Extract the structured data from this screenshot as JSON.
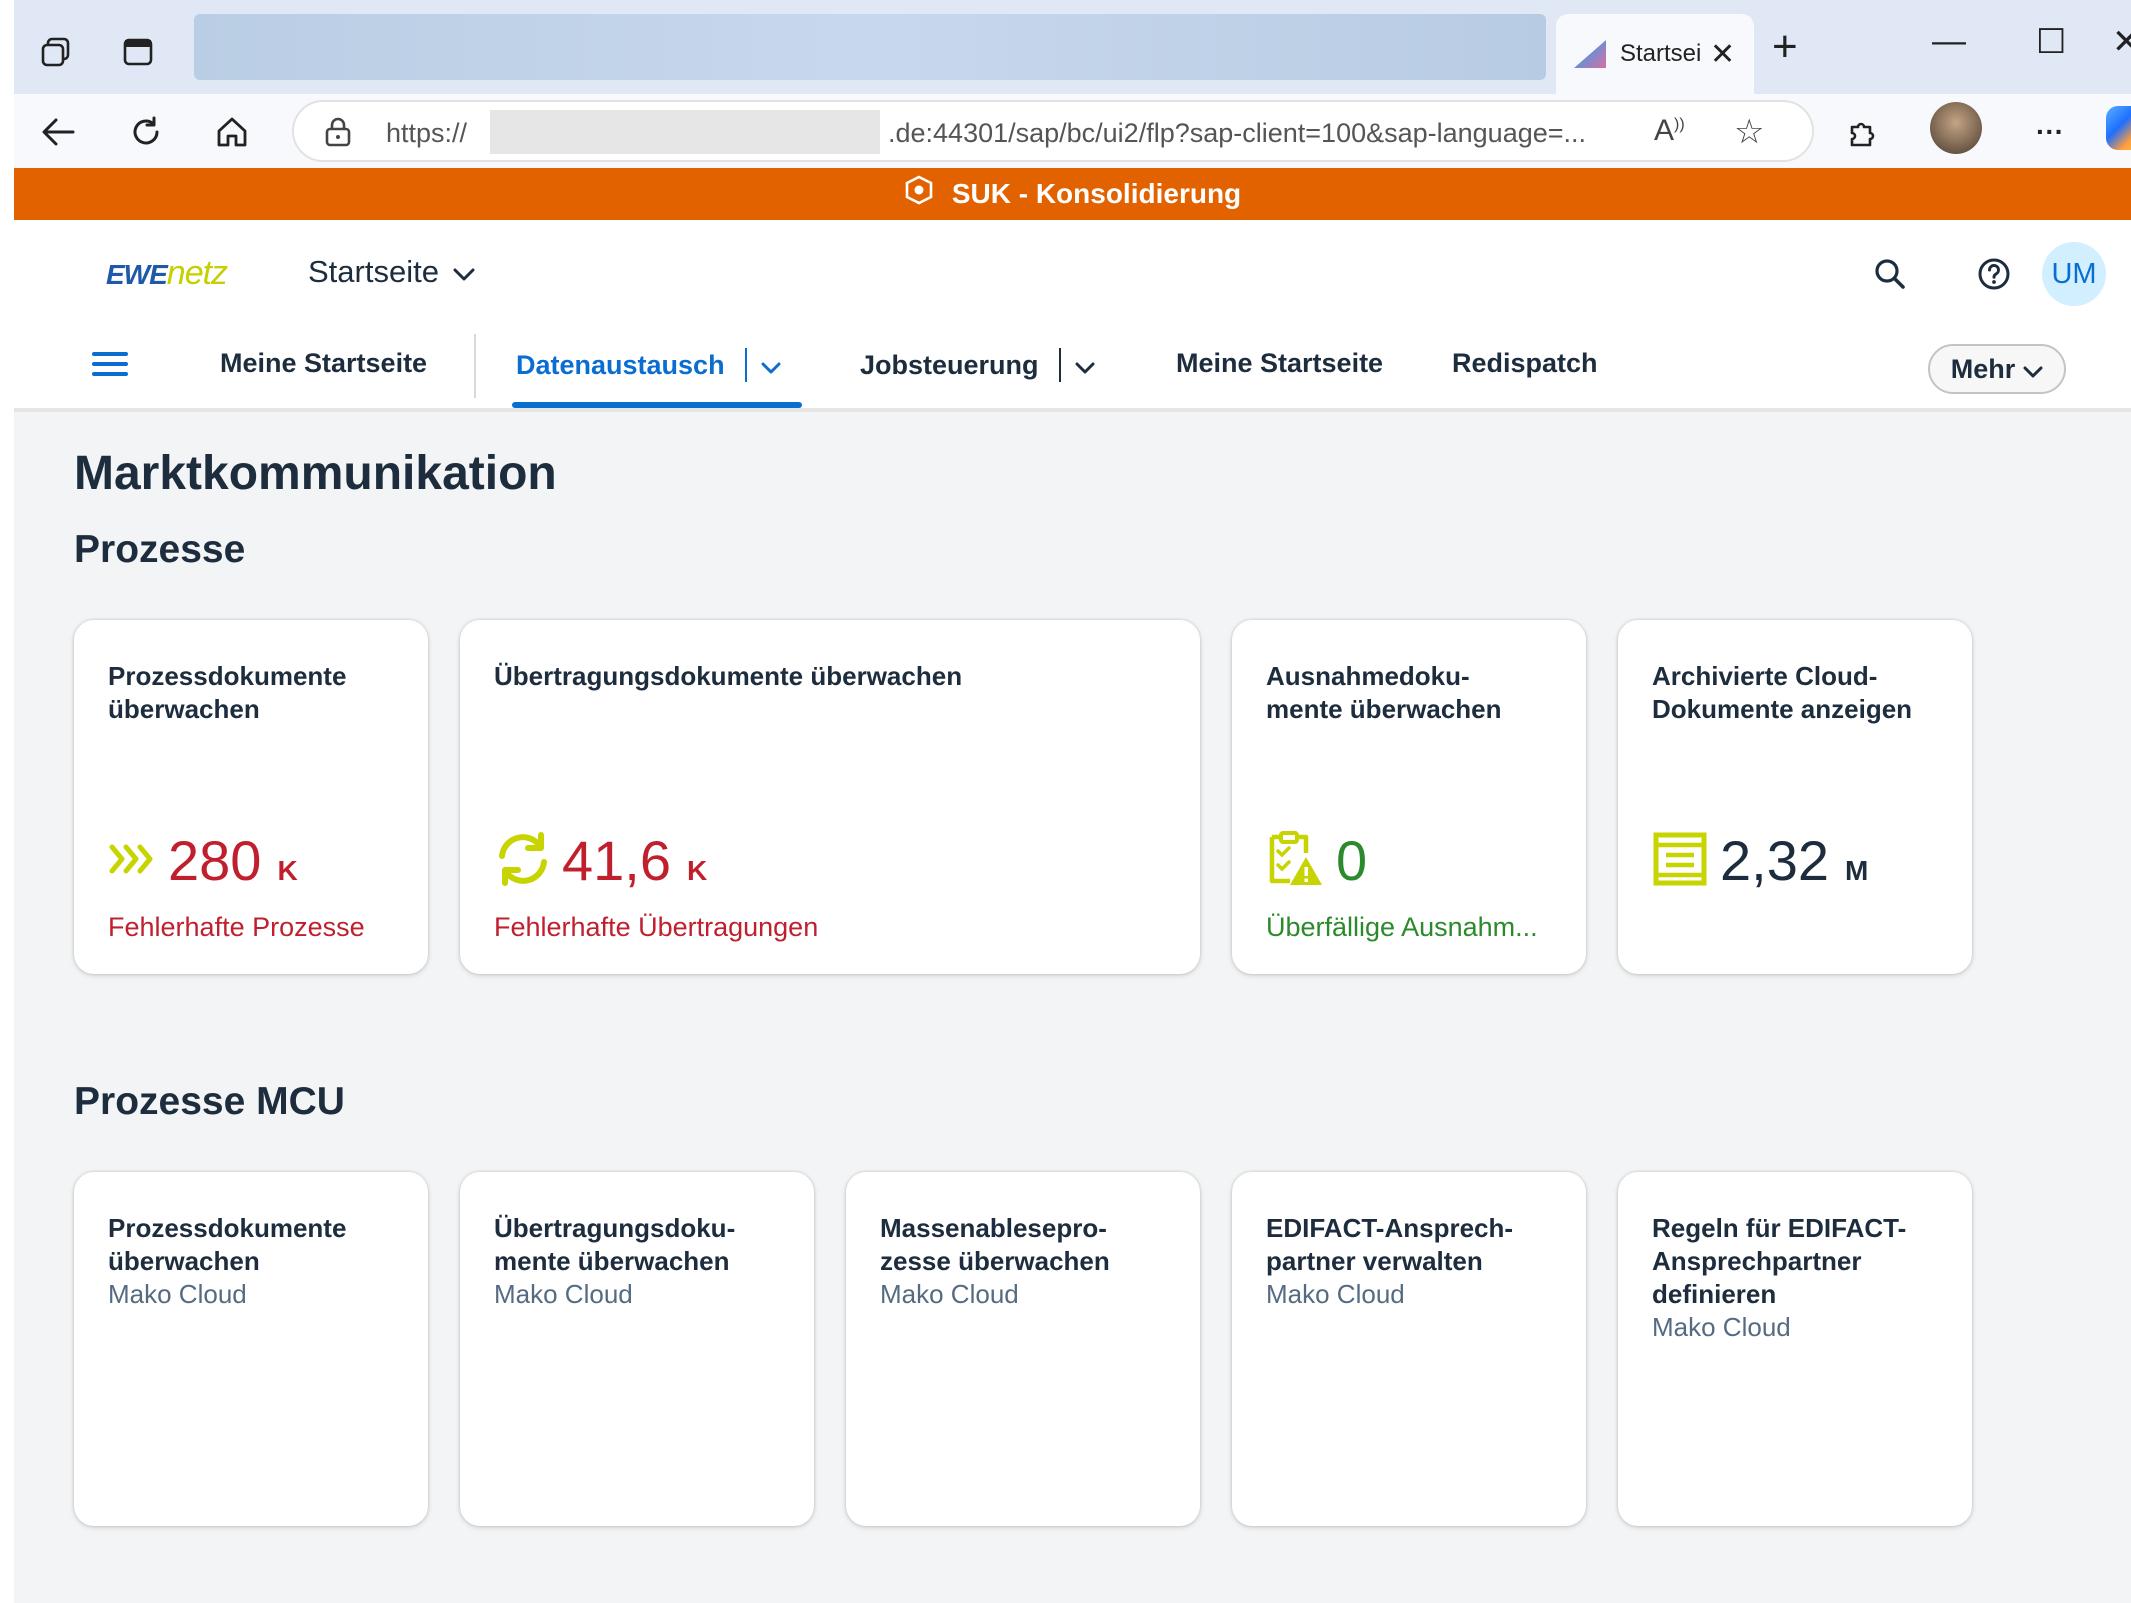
{
  "browser": {
    "tab_title": "Startseite",
    "new_tab": "+",
    "url_prefix": "https://",
    "url_rest": ".de:44301/sap/bc/ui2/flp?sap-client=100&sap-language=...",
    "read_aloud": "A",
    "more": "···"
  },
  "system_bar": {
    "title": "SUK - Konsolidierung"
  },
  "shell": {
    "logo_ewe": "EWE",
    "logo_netz": "netz",
    "home_label": "Startseite",
    "user_initials": "UM"
  },
  "spaces": {
    "items": [
      {
        "label": "Meine Startseite"
      },
      {
        "label": "Datenaustausch"
      },
      {
        "label": "Jobsteuerung"
      },
      {
        "label": "Meine Startseite"
      },
      {
        "label": "Redispatch"
      }
    ],
    "more_label": "Mehr"
  },
  "page": {
    "title": "Marktkommunikation",
    "sections": [
      {
        "title": "Prozesse",
        "tiles": [
          {
            "title": "Prozessdokumente überwachen",
            "value": "280",
            "unit": "K",
            "footer": "Fehlerhafte Prozesse"
          },
          {
            "title": "Übertragungsdokumente überwachen",
            "value": "41,6",
            "unit": "K",
            "footer": "Fehlerhafte Übertragungen"
          },
          {
            "title": "Ausnahmedoku-\nmente überwachen",
            "value": "0",
            "unit": "",
            "footer": "Überfällige Ausnahm..."
          },
          {
            "title": "Archivierte Cloud-\nDokumente anzeigen",
            "value": "2,32",
            "unit": "M",
            "footer": ""
          }
        ]
      },
      {
        "title": "Prozesse MCU",
        "tiles": [
          {
            "title": "Prozessdokumente überwachen",
            "subtitle": "Mako Cloud"
          },
          {
            "title": "Übertragungsdoku-\nmente überwachen",
            "subtitle": "Mako Cloud"
          },
          {
            "title": "Massenablesepro-\nzesse überwachen",
            "subtitle": "Mako Cloud"
          },
          {
            "title": "EDIFACT-Ansprech-\npartner verwalten",
            "subtitle": "Mako Cloud"
          },
          {
            "title": "Regeln für EDIFACT-\nAnsprechpartner\ndefinieren",
            "subtitle": "Mako Cloud"
          }
        ]
      }
    ]
  },
  "colors": {
    "system_bar": "#e26200",
    "accent": "#0a6ed1",
    "error": "#c0202e",
    "success": "#2c8a2c",
    "logo_blue": "#1e5aa8",
    "logo_green": "#c6cf00",
    "icon_lime": "#c8d400"
  },
  "icons": {
    "browser": [
      "workspaces-icon",
      "tab-actions-icon",
      "back-icon",
      "refresh-icon",
      "home-icon",
      "lock-icon",
      "read-aloud-icon",
      "favorite-star-icon",
      "extensions-icon",
      "profile-avatar-icon",
      "more-icon",
      "copilot-icon",
      "minimize-icon",
      "maximize-icon",
      "close-icon"
    ],
    "shell": [
      "search-icon",
      "help-icon",
      "menu-icon",
      "chevron-down-icon"
    ],
    "tiles": [
      "forward-arrows-icon",
      "sync-icon",
      "clipboard-warning-icon",
      "archive-document-icon"
    ]
  }
}
